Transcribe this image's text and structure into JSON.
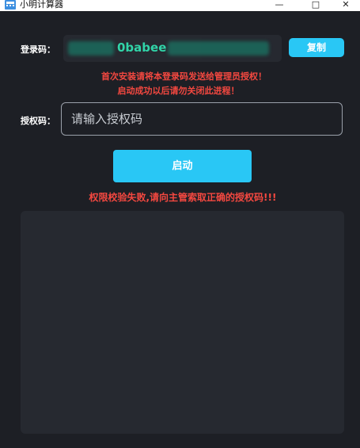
{
  "window": {
    "title": "小明计算器",
    "minimize": "—",
    "maximize": "□",
    "close": "✕"
  },
  "login": {
    "label": "登录码：",
    "code_visible": "0babee",
    "copy_button": "复制"
  },
  "notices": {
    "line1": "首次安装请将本登录码发送给管理员授权！",
    "line2": "启动成功以后请勿关闭此进程！"
  },
  "auth": {
    "label": "授权码：",
    "placeholder": "请输入授权码",
    "value": ""
  },
  "start_button": "启动",
  "error_message": "权限校验失败,请向主管索取正确的授权码!!!",
  "colors": {
    "background": "#1d1f25",
    "panel": "#262930",
    "accent": "#29c7f5",
    "error": "#f44840",
    "code": "#31d4a8"
  }
}
